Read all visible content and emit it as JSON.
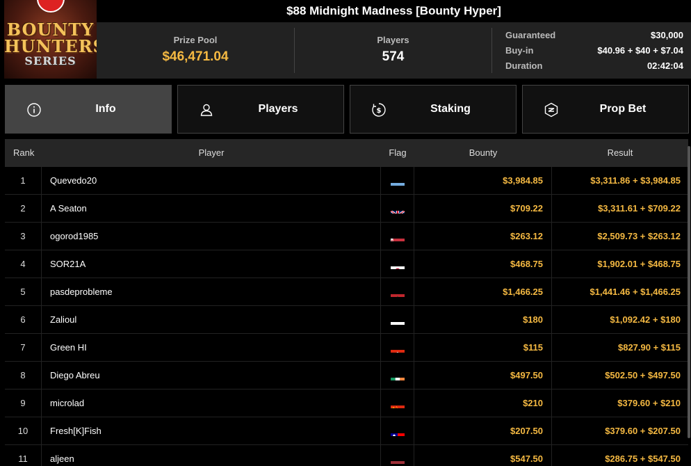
{
  "logo": {
    "line1": "BOUNTY",
    "line2": "HUNTERS",
    "line3": "SERIES"
  },
  "tournament": {
    "title": "$88 Midnight Madness [Bounty Hyper]"
  },
  "summary": {
    "prize_pool_label": "Prize Pool",
    "prize_pool_value": "$46,471.04",
    "players_label": "Players",
    "players_value": "574",
    "guaranteed_label": "Guaranteed",
    "guaranteed_value": "$30,000",
    "buyin_label": "Buy-in",
    "buyin_value": "$40.96 + $40 + $7.04",
    "duration_label": "Duration",
    "duration_value": "02:42:04"
  },
  "tabs": [
    {
      "label": "Info",
      "icon": "info-icon",
      "active": true
    },
    {
      "label": "Players",
      "icon": "user-icon",
      "active": false
    },
    {
      "label": "Staking",
      "icon": "dollar-coin-icon",
      "active": false
    },
    {
      "label": "Prop Bet",
      "icon": "prop-bet-icon",
      "active": false
    }
  ],
  "table": {
    "headers": {
      "rank": "Rank",
      "player": "Player",
      "flag": "Flag",
      "bounty": "Bounty",
      "result": "Result"
    },
    "rows": [
      {
        "rank": "1",
        "player": "Quevedo20",
        "flag": "argentina",
        "bounty": "$3,984.85",
        "result": "$3,311.86 + $3,984.85"
      },
      {
        "rank": "2",
        "player": "A Seaton",
        "flag": "united-kingdom",
        "bounty": "$709.22",
        "result": "$3,311.61 + $709.22"
      },
      {
        "rank": "3",
        "player": "ogorod1985",
        "flag": "belarus",
        "bounty": "$263.12",
        "result": "$2,509.73 + $263.12"
      },
      {
        "rank": "4",
        "player": "SOR21A",
        "flag": "japan",
        "bounty": "$468.75",
        "result": "$1,902.01 + $468.75"
      },
      {
        "rank": "5",
        "player": "pasdeprobleme",
        "flag": "morocco",
        "bounty": "$1,466.25",
        "result": "$1,441.46 + $1,466.25"
      },
      {
        "rank": "6",
        "player": "Zalioul",
        "flag": "poland",
        "bounty": "$180",
        "result": "$1,092.42 + $180"
      },
      {
        "rank": "7",
        "player": "Green HI",
        "flag": "hong-kong",
        "bounty": "$115",
        "result": "$827.90 + $115"
      },
      {
        "rank": "8",
        "player": "Diego Abreu",
        "flag": "ireland",
        "bounty": "$497.50",
        "result": "$502.50 + $497.50"
      },
      {
        "rank": "9",
        "player": "microlad",
        "flag": "china",
        "bounty": "$210",
        "result": "$379.60 + $210"
      },
      {
        "rank": "10",
        "player": "Fresh[K]Fish",
        "flag": "taiwan",
        "bounty": "$207.50",
        "result": "$379.60 + $207.50"
      },
      {
        "rank": "11",
        "player": "aljeen",
        "flag": "latvia",
        "bounty": "$547.50",
        "result": "$286.75 + $547.50"
      }
    ]
  },
  "colors": {
    "accent": "#f5b942",
    "panel": "#222222",
    "tab_active": "#444444",
    "header_row": "#262626"
  }
}
